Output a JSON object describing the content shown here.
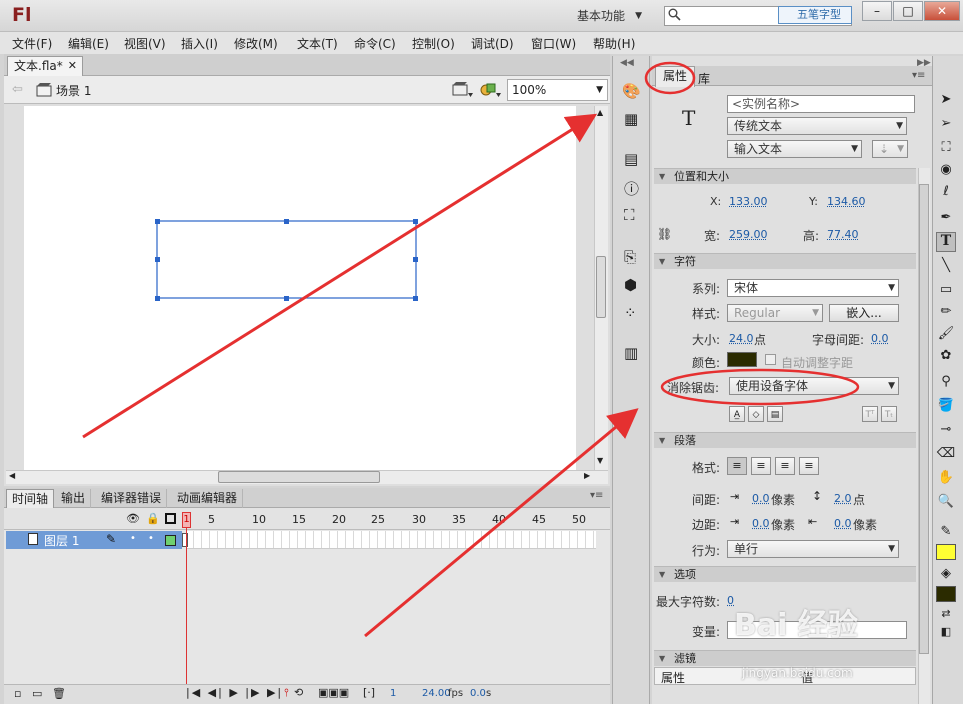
{
  "app": {
    "logo": "Fl",
    "workspace": "基本功能",
    "search_placeholder": "",
    "watermark_top": "五笔字型",
    "window_buttons": [
      "–",
      "□",
      "✕"
    ]
  },
  "menu": [
    "文件(F)",
    "编辑(E)",
    "视图(V)",
    "插入(I)",
    "修改(M)",
    "文本(T)",
    "命令(C)",
    "控制(O)",
    "调试(D)",
    "窗口(W)",
    "帮助(H)"
  ],
  "document": {
    "tab": "文本.fla*",
    "scene": "场景 1",
    "zoom": "100%"
  },
  "timeline": {
    "tabs": [
      "时间轴",
      "输出",
      "编译器错误",
      "动画编辑器"
    ],
    "layer_name": "图层 1",
    "frame_numbers": [
      "1",
      "5",
      "10",
      "15",
      "20",
      "25",
      "30",
      "35",
      "40",
      "45",
      "50"
    ],
    "current_frame": "1",
    "fps": "24.00",
    "fps_unit": "fps",
    "time": "0.0",
    "time_unit": "s"
  },
  "properties": {
    "tabs": [
      "属性",
      "库"
    ],
    "instance_name_placeholder": "<实例名称>",
    "text_engine": "传统文本",
    "text_type": "输入文本",
    "position_section": "位置和大小",
    "x_label": "X:",
    "x": "133.00",
    "y_label": "Y:",
    "y": "134.60",
    "w_label": "宽:",
    "w": "259.00",
    "h_label": "高:",
    "h": "77.40",
    "char_section": "字符",
    "family_label": "系列:",
    "family": "宋体",
    "style_label": "样式:",
    "style": "Regular",
    "embed_button": "嵌入...",
    "size_label": "大小:",
    "size": "24.0",
    "size_unit": "点",
    "spacing_label": "字母间距:",
    "spacing": "0.0",
    "color_label": "颜色:",
    "autokern": "自动调整字距",
    "antialias_label": "消除锯齿:",
    "antialias": "使用设备字体",
    "para_section": "段落",
    "format_label": "格式:",
    "spacing2_label": "间距:",
    "indent": "0.0",
    "indent_unit": "像素",
    "line_spacing": "2.0",
    "line_spacing_unit": "点",
    "margin_label": "边距:",
    "margin_left": "0.0",
    "margin_left_unit": "像素",
    "margin_right": "0.0",
    "margin_right_unit": "像素",
    "behavior_label": "行为:",
    "behavior": "单行",
    "options_section": "选项",
    "max_chars_label": "最大字符数:",
    "max_chars": "0",
    "variable_label": "变量:",
    "filters_section": "滤镜",
    "filter_col_prop": "属性",
    "filter_col_value": "值"
  },
  "colors": {
    "text_color": "#2b2b00",
    "stroke_swatch": "#2b2b00",
    "fill_swatch": "#ffff33",
    "annotation": "#e53030",
    "selection": "#2a64c8"
  },
  "watermark": {
    "main": "Bai 经验",
    "sub": "jingyan.baidu.com"
  }
}
